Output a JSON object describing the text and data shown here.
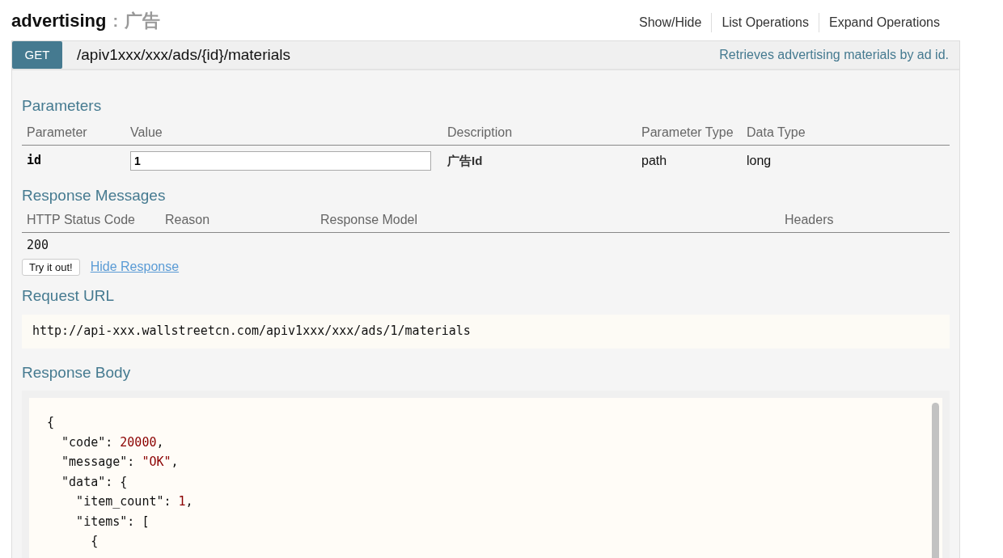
{
  "resource": {
    "name": "advertising",
    "separator": ":",
    "description": "广告"
  },
  "header_links": [
    "Show/Hide",
    "List Operations",
    "Expand Operations"
  ],
  "operation": {
    "method": "GET",
    "path": "/apiv1xxx/xxx/ads/{id}/materials",
    "summary": "Retrieves advertising materials by ad id."
  },
  "parameters": {
    "title": "Parameters",
    "columns": [
      "Parameter",
      "Value",
      "Description",
      "Parameter Type",
      "Data Type"
    ],
    "rows": [
      {
        "name": "id",
        "value": "1",
        "description": "广告Id",
        "parameter_type": "path",
        "data_type": "long"
      }
    ]
  },
  "response_messages": {
    "title": "Response Messages",
    "columns": [
      "HTTP Status Code",
      "Reason",
      "Response Model",
      "Headers"
    ],
    "rows": [
      {
        "status_code": "200"
      }
    ]
  },
  "try_button": "Try it out!",
  "hide_link": "Hide Response",
  "request_url": {
    "title": "Request URL",
    "value": "http://api-xxx.wallstreetcn.com/apiv1xxx/xxx/ads/1/materials"
  },
  "response_body": {
    "title": "Response Body",
    "lines": [
      [
        {
          "kind": "plain",
          "text": "{"
        }
      ],
      [
        {
          "kind": "plain",
          "text": "  \"code\": "
        },
        {
          "kind": "value",
          "text": "20000"
        },
        {
          "kind": "plain",
          "text": ","
        }
      ],
      [
        {
          "kind": "plain",
          "text": "  \"message\": "
        },
        {
          "kind": "value",
          "text": "\"OK\""
        },
        {
          "kind": "plain",
          "text": ","
        }
      ],
      [
        {
          "kind": "plain",
          "text": "  \"data\": {"
        }
      ],
      [
        {
          "kind": "plain",
          "text": "    \"item_count\": "
        },
        {
          "kind": "value",
          "text": "1"
        },
        {
          "kind": "plain",
          "text": ","
        }
      ],
      [
        {
          "kind": "plain",
          "text": "    \"items\": ["
        }
      ],
      [
        {
          "kind": "plain",
          "text": "      {"
        }
      ]
    ]
  }
}
